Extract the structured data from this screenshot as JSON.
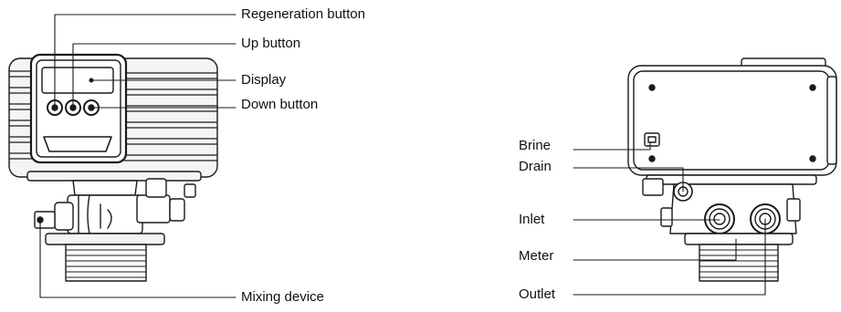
{
  "labels": {
    "regeneration_button": "Regeneration button",
    "up_button": "Up button",
    "display": "Display",
    "down_button": "Down button",
    "mixing_device": "Mixing device",
    "brine": "Brine",
    "drain": "Drain",
    "inlet": "Inlet",
    "meter": "Meter",
    "outlet": "Outlet"
  }
}
